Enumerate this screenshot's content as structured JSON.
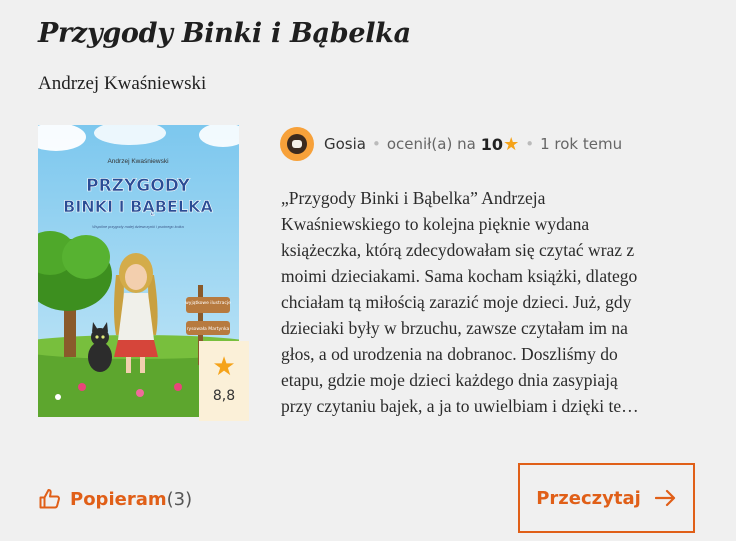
{
  "book": {
    "title": "Przygody Binki i Bąbelka",
    "author": "Andrzej Kwaśniewski",
    "cover": {
      "author": "Andrzej Kwaśniewski",
      "title_line1": "PRZYGODY",
      "title_line2": "BINKI I BĄBELKA",
      "tagline": "Wspólne przygody małej dziewczynki i psotnego kotka",
      "sign1": "wyjątkowe ilustracje",
      "sign2": "rysowała Martynka"
    },
    "rating": "8,8"
  },
  "review": {
    "user": "Gosia",
    "rated_label": "ocenił(a) na",
    "score": "10",
    "time": "1 rok temu",
    "text_lines": [
      "„Przygody Binki i Bąbelka” Andrzeja",
      "Kwaśniewskiego to kolejna pięknie wydana",
      "książeczka, którą zdecydowałam się czytać wraz z",
      "moimi dzieciakami. Sama kocham książki, dlatego",
      "chciałam tą miłością zarazić moje dzieci. Już, gdy",
      "dzieciaki były w brzuchu, zawsze czytałam im na",
      "głos, a od urodzenia na dobranoc. Doszliśmy do",
      "etapu, gdzie moje dzieci każdego dnia zasypiają",
      "przy czytaniu bajek, a ja to uwielbiam i dzięki te…"
    ]
  },
  "actions": {
    "like_label": "Popieram",
    "like_count": "(3)",
    "read_label": "Przeczytaj"
  },
  "colors": {
    "accent": "#e05f18",
    "star": "#f5a31a",
    "background": "#f0f0f0",
    "rating_badge_bg": "#fbf0d8"
  },
  "icons": {
    "like": "thumbs-up-icon",
    "read": "arrow-right-icon",
    "rating": "star-icon"
  }
}
